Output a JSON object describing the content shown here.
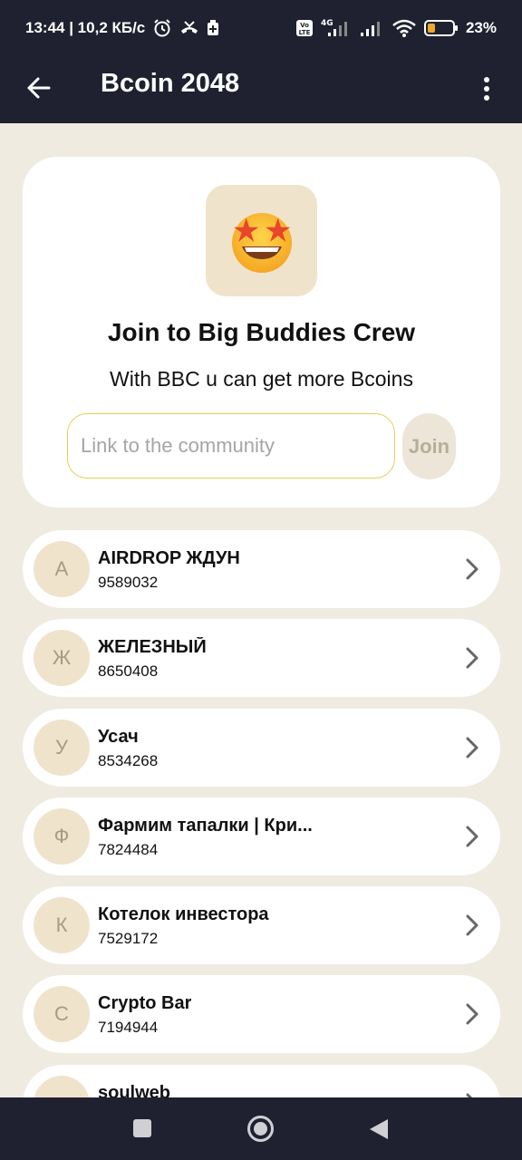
{
  "status_bar": {
    "left_text": "13:44 | 10,2 КБ/с",
    "battery": "23",
    "icons": [
      "alarm-icon",
      "missed-call-icon",
      "battery-saver-icon",
      "volte-icon",
      "signal-4g-icon",
      "signal-icon",
      "wifi-icon",
      "battery-icon"
    ]
  },
  "app_bar": {
    "title": "Bcoin 2048",
    "back_icon": "arrow-left-icon",
    "menu_icon": "more-vertical-icon"
  },
  "join_card": {
    "emoji": "🤩",
    "title": "Join to Big Buddies Crew",
    "subtitle": "With BBC u can get more Bcoins",
    "input_value": "",
    "input_placeholder": "Link to the community",
    "join_label": "Join"
  },
  "list": [
    {
      "initial": "A",
      "name": "AIRDROP ЖДУН",
      "score": "9589032"
    },
    {
      "initial": "Ж",
      "name": "ЖЕЛЕЗНЫЙ",
      "score": "8650408"
    },
    {
      "initial": "У",
      "name": "Усач",
      "score": "8534268"
    },
    {
      "initial": "Ф",
      "name": "Фармим тапалки | Кри...",
      "score": "7824484"
    },
    {
      "initial": "К",
      "name": "Котелок инвестора",
      "score": "7529172"
    },
    {
      "initial": "C",
      "name": "Crypto Bar",
      "score": "7194944"
    },
    {
      "initial": "",
      "name": "soulweb",
      "score": ""
    }
  ],
  "nav_bar": {
    "icons": [
      "recents-square-icon",
      "home-circle-icon",
      "back-triangle-icon"
    ]
  },
  "colors": {
    "header_bg": "#1f2130",
    "page_bg": "#efebe1",
    "avatar_bg": "#f0e3cc",
    "input_border": "#e4cf55"
  }
}
